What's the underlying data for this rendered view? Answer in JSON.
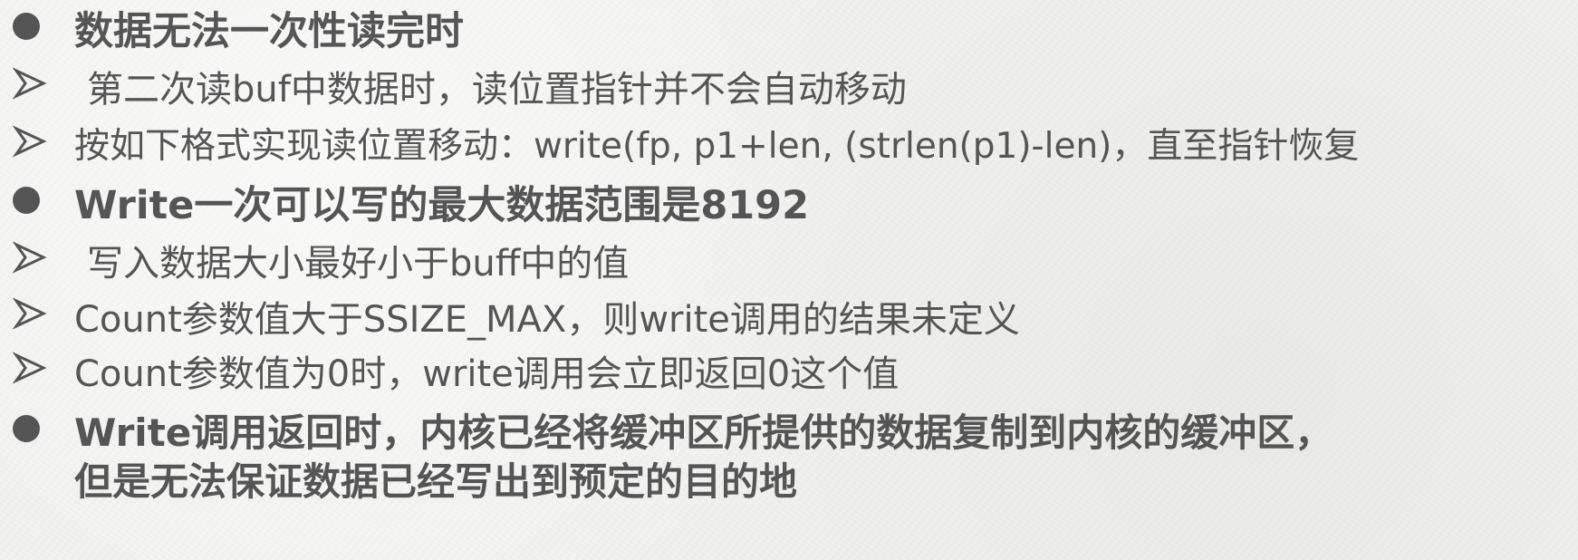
{
  "bullets": [
    {
      "level": 1,
      "marker": "dot",
      "text": "数据无法一次性读完时"
    },
    {
      "level": 2,
      "marker": "arrow",
      "text": "第二次读buf中数据时，读位置指针并不会自动移动"
    },
    {
      "level": 2,
      "marker": "arrow",
      "text": "按如下格式实现读位置移动：write(fp, p1+len, (strlen(p1)-len)，直至指针恢复"
    },
    {
      "level": 1,
      "marker": "dot",
      "text": "Write一次可以写的最大数据范围是8192"
    },
    {
      "level": 2,
      "marker": "arrow",
      "text": "写入数据大小最好小于buff中的值"
    },
    {
      "level": 2,
      "marker": "arrow",
      "text": "Count参数值大于SSIZE_MAX，则write调用的结果未定义"
    },
    {
      "level": 2,
      "marker": "arrow",
      "text": "Count参数值为0时，write调用会立即返回0这个值"
    },
    {
      "level": 1,
      "marker": "dot",
      "text": "Write调用返回时，内核已经将缓冲区所提供的数据复制到内核的缓冲区，",
      "continuation": "但是无法保证数据已经写出到预定的目的地"
    }
  ],
  "colors": {
    "text": "#555555",
    "background": "#f2f2f0"
  }
}
